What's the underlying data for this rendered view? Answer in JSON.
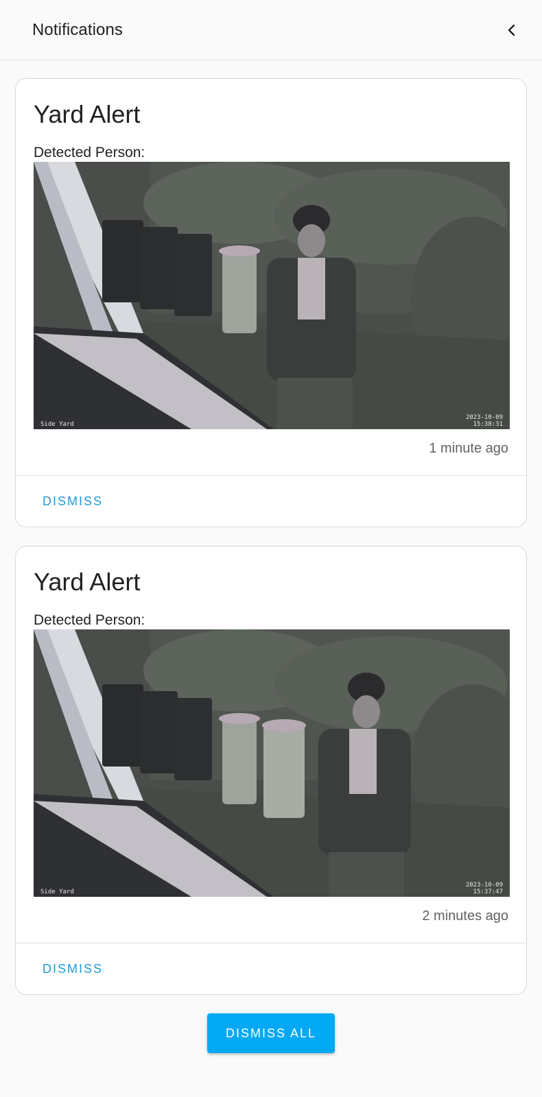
{
  "header": {
    "title": "Notifications",
    "back_icon": "chevron-left-icon"
  },
  "notifications": [
    {
      "title": "Yard Alert",
      "message": "Detected Person:",
      "camera_label": "Side Yard",
      "camera_date": "2023-10-09",
      "camera_time": "15:38:31",
      "time_ago": "1 minute ago",
      "dismiss_label": "DISMISS"
    },
    {
      "title": "Yard Alert",
      "message": "Detected Person:",
      "camera_label": "Side Yard",
      "camera_date": "2023-10-09",
      "camera_time": "15:37:47",
      "time_ago": "2 minutes ago",
      "dismiss_label": "DISMISS"
    }
  ],
  "dismiss_all_label": "DISMISS ALL",
  "colors": {
    "accent": "#03a9f4",
    "link": "#1e9bd7"
  }
}
